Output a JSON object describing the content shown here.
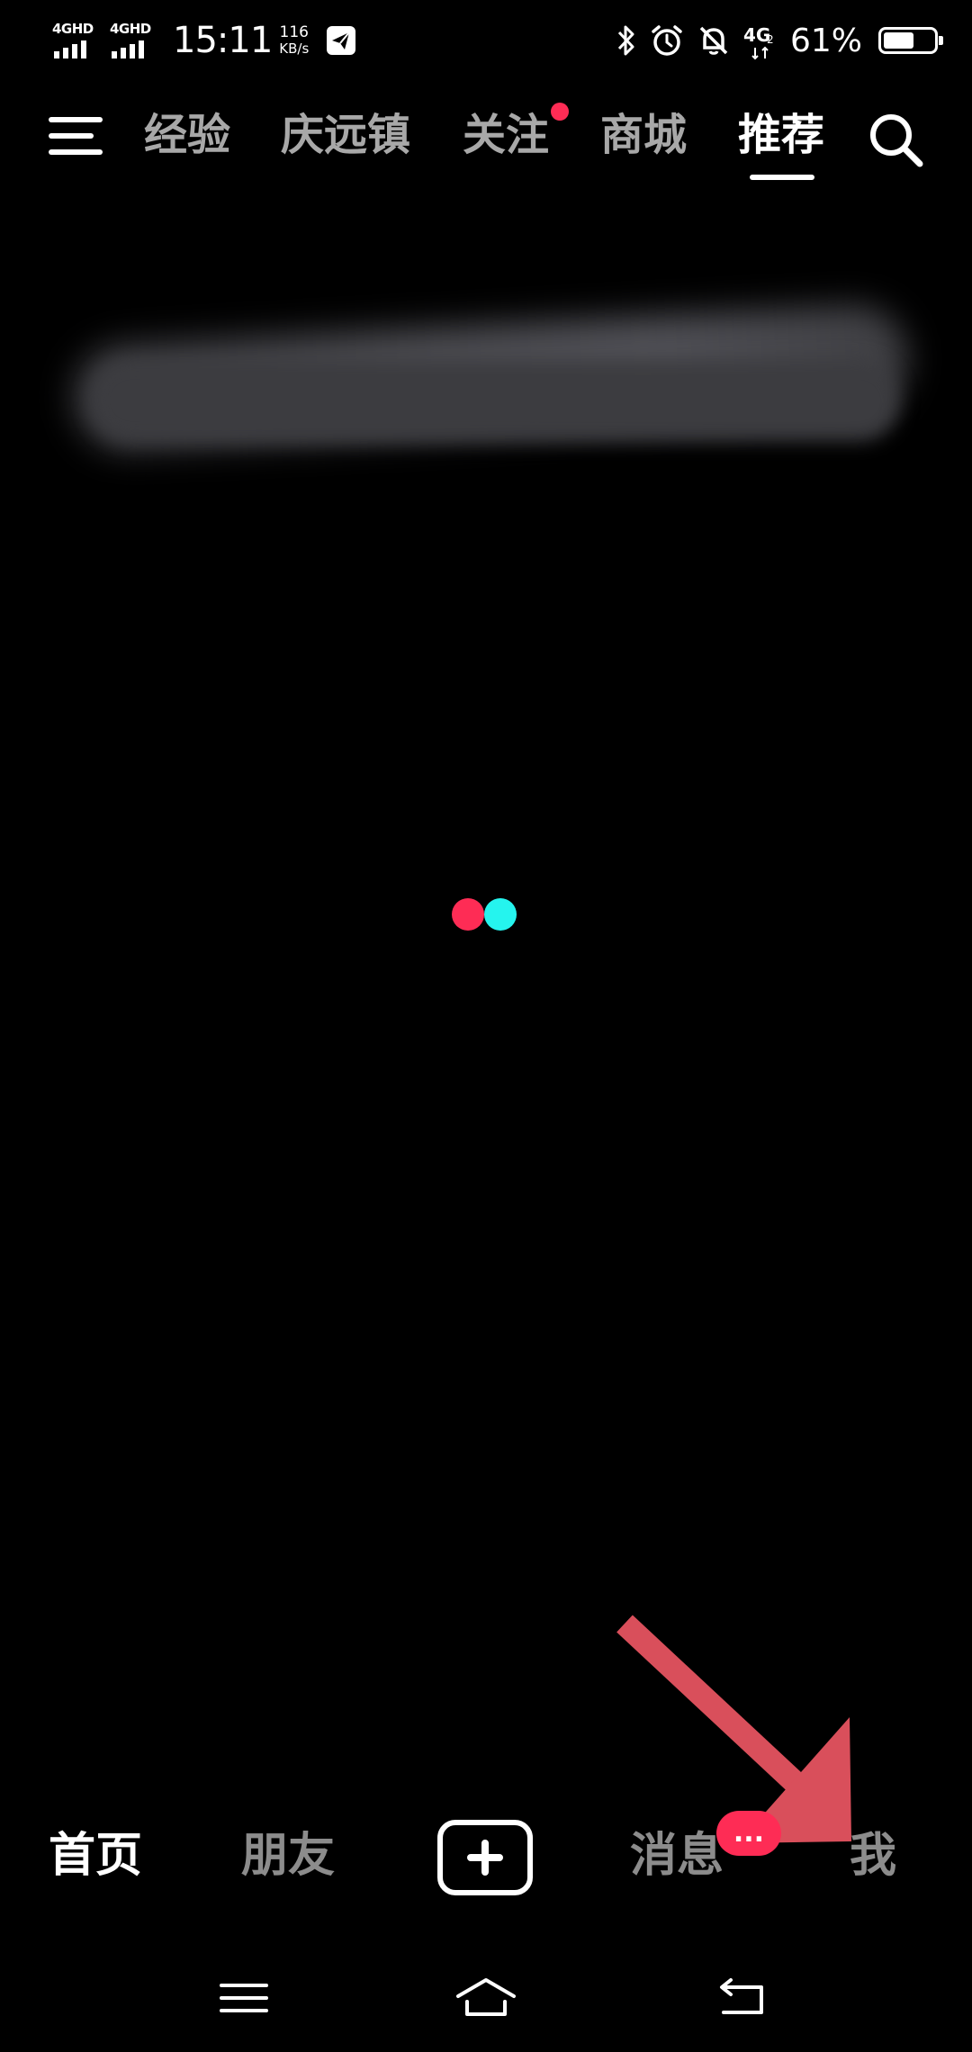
{
  "status_bar": {
    "signal1_label": "4GHD",
    "signal2_label": "4GHD",
    "time": "15:11",
    "speed_value": "116",
    "speed_unit": "KB/s",
    "network_label": "4G",
    "network_sub": "2",
    "battery_percent": "61%",
    "battery_level": 0.61,
    "icons": [
      "telegram-icon",
      "bluetooth-icon",
      "alarm-icon",
      "notifications-off-icon",
      "4g-network-icon",
      "battery-icon"
    ]
  },
  "top_nav": {
    "menu_icon": "hamburger-menu-icon",
    "tabs": [
      {
        "label": "经验",
        "active": false
      },
      {
        "label": "庆远镇",
        "active": false
      },
      {
        "label": "关注",
        "active": false,
        "dot": true
      },
      {
        "label": "商城",
        "active": false
      },
      {
        "label": "推荐",
        "active": true
      }
    ],
    "search_icon": "search-icon"
  },
  "loader": {
    "colors": [
      "#fe2c55",
      "#25f4ee"
    ]
  },
  "bottom_nav": {
    "items": [
      {
        "label": "首页",
        "active": true
      },
      {
        "label": "朋友",
        "active": false
      },
      {
        "label": "消息",
        "active": false,
        "badge": "..."
      },
      {
        "label": "我",
        "active": false
      }
    ],
    "create_icon": "plus-square-icon"
  },
  "system_nav": {
    "icons": [
      "menu-icon",
      "home-icon",
      "back-icon"
    ]
  },
  "colors": {
    "background": "#000000",
    "accent_red": "#fe2c55",
    "accent_cyan": "#25f4ee",
    "annotation_arrow": "#e05560"
  }
}
